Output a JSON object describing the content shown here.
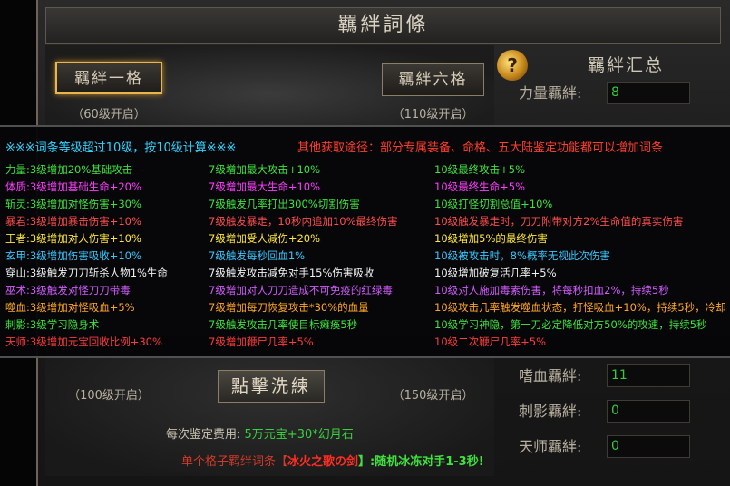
{
  "title": "羈絆詞條",
  "slots": {
    "first_label": "羈絆一格",
    "first_open": "（60级开启）",
    "sixth_label": "羈絆六格",
    "sixth_open": "（110级开启）",
    "bottom_left_open": "（100级开启）",
    "bottom_right_open": "（150级开启）"
  },
  "summary": {
    "title": "羈絆汇总",
    "rows": [
      {
        "label": "力量羈絆:",
        "value": "8"
      },
      {
        "label": "嗜血羈絆:",
        "value": "11"
      },
      {
        "label": "刺影羈絆:",
        "value": "0"
      },
      {
        "label": "天师羈絆:",
        "value": "0"
      }
    ]
  },
  "popup": {
    "header_left": "※※※词条等级超过10级，按10级计算※※※",
    "header_right": "其他获取途径：部分专属装备、命格、五大陆鉴定功能都可以增加词条",
    "rows": [
      {
        "name": "力量:",
        "c0": "3级增加20%基础攻击",
        "c1": "7级增加最大攻击+10%",
        "c2": "10级最终攻击+5%",
        "color": "#3ee33e"
      },
      {
        "name": "体质:",
        "c0": "3级增加基础生命+20%",
        "c1": "7级增加最大生命+10%",
        "c2": "10级最终生命+5%",
        "color": "#ff3dff"
      },
      {
        "name": "斩灵:",
        "c0": "3级增加对怪伤害+30%",
        "c1": "7级触发几率打出300%切割伤害",
        "c2": "10级打怪切割总值+10%",
        "color": "#3ee33e"
      },
      {
        "name": "暴君:",
        "c0": "3级增加暴击伤害+10%",
        "c1": "7级触发暴走，10秒内追加10%最终伤害",
        "c2": "10级触发暴走时，刀刀附带对方2%生命值的真实伤害",
        "color": "#ff4d4d"
      },
      {
        "name": "王者:",
        "c0": "3级增加对人伤害+10%",
        "c1": "7级增加受人减伤+20%",
        "c2": "10级增加5%的最终伤害",
        "color": "#ffe83a"
      },
      {
        "name": "玄甲:",
        "c0": "3级增加伤害吸收+10%",
        "c1": "7级触发每秒回血1%",
        "c2": "10级被攻击时，8%概率无视此次伤害",
        "color": "#37c8ff"
      },
      {
        "name": "穿山:",
        "c0": "3级触发刀刀斩杀人物1%生命",
        "c1": "7级触发攻击减免对手15%伤害吸收",
        "c2": "10级增加破复活几率+5%",
        "color": "#f2f2f2"
      },
      {
        "name": "巫术:",
        "c0": "3级触发对怪刀刀带毒",
        "c1": "7级增加对人刀刀造成不可免疫的红绿毒",
        "c2": "10级对人施加毒素伤害，将每秒扣血2%，持续5秒",
        "color": "#d25bff"
      },
      {
        "name": "噬血:",
        "c0": "3级增加对怪吸血+5%",
        "c1": "7级增加每刀恢复攻击*30%的血量",
        "c2": "10级攻击几率触发噬血状态，打怪吸血+10%，持续5秒，冷却",
        "color": "#ffa624"
      },
      {
        "name": "刺影:",
        "c0": "3级学习隐身术",
        "c1": "7级触发攻击几率使目标瘫痪5秒",
        "c2": "10级学习神隐，第一刀必定降低对方50%的攻速，持续5秒",
        "color": "#3ee33e"
      },
      {
        "name": "天师:",
        "c0": "3级增加元宝回收比例+30%",
        "c1": "7级增加鞭尸几率+5%",
        "c2": "10级二次鞭尸几率+5%",
        "color": "#ff3b3b"
      }
    ]
  },
  "wash_button": "點擊洗練",
  "cost": {
    "label": "每次鉴定费用:",
    "value": "5万元宝+30*幻月石"
  },
  "hint": {
    "prefix": "单个格子羁绊词条【",
    "item": "冰火之歌の剑",
    "suffix": "】:随机冰冻对手1-3秒!"
  },
  "icons": {
    "summary_gem": "question-gem-icon"
  },
  "colors": {
    "header_left": "#2fd3ff",
    "header_right": "#ff3d2d",
    "value_green": "#36c93c"
  }
}
